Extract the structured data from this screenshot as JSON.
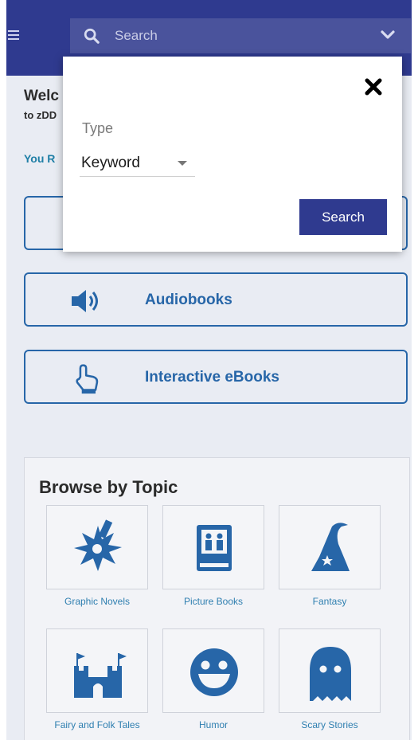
{
  "header": {
    "menu_icon": "hamburger-icon",
    "search": {
      "placeholder": "Search",
      "icon": "search-icon",
      "chevron_icon": "chevron-down-icon"
    }
  },
  "welcome": {
    "title_partial": "Welc",
    "subtitle_partial": "to zDD",
    "you_partial": "You R"
  },
  "media_buttons": [
    {
      "label": "Audiobooks",
      "icon": "speaker-icon"
    },
    {
      "label": "Interactive eBooks",
      "icon": "touch-hand-icon"
    }
  ],
  "browse": {
    "title": "Browse by Topic",
    "topics": [
      {
        "label": "Graphic Novels",
        "icon": "burst-icon"
      },
      {
        "label": "Picture Books",
        "icon": "picture-book-icon"
      },
      {
        "label": "Fantasy",
        "icon": "wizard-hat-icon"
      },
      {
        "label": "Fairy and Folk Tales",
        "icon": "castle-icon"
      },
      {
        "label": "Humor",
        "icon": "smiley-icon"
      },
      {
        "label": "Scary Stories",
        "icon": "ghost-icon"
      }
    ]
  },
  "search_modal": {
    "type_label": "Type",
    "type_value": "Keyword",
    "search_button": "Search",
    "close_icon": "close-icon"
  },
  "colors": {
    "header": "#2f3a8f",
    "accent": "#2766a8",
    "link": "#1f7fa6"
  }
}
